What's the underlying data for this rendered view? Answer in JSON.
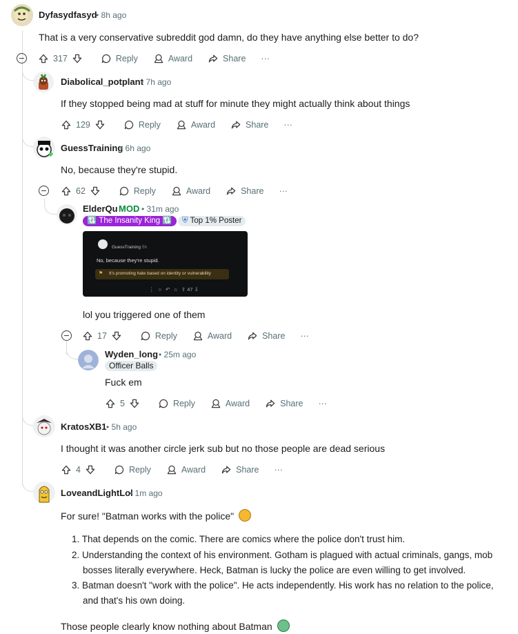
{
  "comments": {
    "c1": {
      "username": "Dyfasydfasyd",
      "time": "8h ago",
      "body": "That is a very conservative subreddit god damn, do they have anything else better to do?",
      "votes": "317"
    },
    "c2": {
      "username": "Diabolical_potplant",
      "time": "7h ago",
      "body": "If they stopped being mad at stuff for minute they might actually think about things",
      "votes": "129"
    },
    "c3": {
      "username": "GuessTraining",
      "time": "6h ago",
      "body": "No, because they're stupid.",
      "votes": "62"
    },
    "c4": {
      "username": "ElderQu",
      "mod": "MOD",
      "time": "31m ago",
      "flair1": "🔃 The Insanity King 🔃",
      "flair2": "Top 1% Poster",
      "body": "lol you triggered one of them",
      "votes": "17",
      "embed": {
        "username": "GuessTraining",
        "time": "5h",
        "body": "No, because they're stupid.",
        "warning": "It's promoting hate based on identity or vulnerability",
        "votes": "47"
      }
    },
    "c5": {
      "username": "Wyden_long",
      "time": "25m ago",
      "flair": "Officer Balls",
      "body": "Fuck em",
      "votes": "5"
    },
    "c6": {
      "username": "KratosXB1",
      "time": "5h ago",
      "body": "I thought it was another circle jerk sub but no those people are dead serious",
      "votes": "4"
    },
    "c7": {
      "username": "LoveandLightLol",
      "time": "1m ago",
      "intro": "For sure! \"Batman works with the police\"",
      "list": [
        "That depends on the comic. There are comics where the police don't trust him.",
        "Understanding the context of his environment. Gotham is plagued with actual criminals, gangs, mob bosses literally everywhere. Heck, Batman is lucky the police are even willing to get involved.",
        "Batman doesn't \"work with the police\". He acts independently. His work has no relation to the police, and that's his own doing."
      ],
      "outro": "Those people clearly know nothing about Batman"
    }
  },
  "labels": {
    "reply": "Reply",
    "award": "Award",
    "share": "Share",
    "more": "···",
    "dot": "•"
  },
  "colors": {
    "mod": "#0a8a3c",
    "flair_purple": "#9b24d6",
    "flair_grey": "#e5ebee",
    "meta": "#576f76"
  }
}
